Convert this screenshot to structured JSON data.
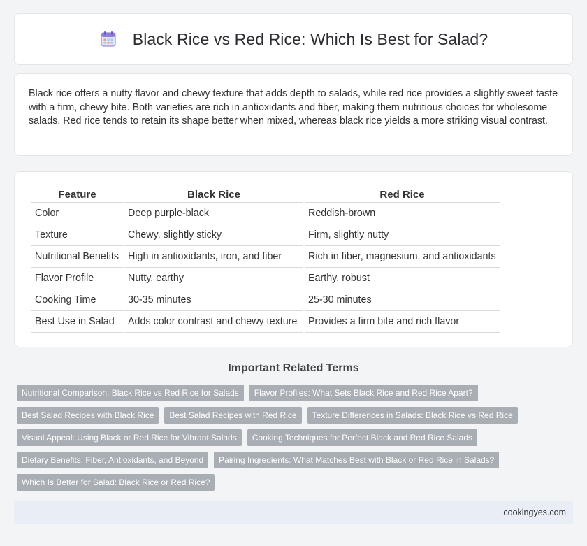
{
  "header": {
    "title": "Black Rice vs Red Rice: Which Is Best for Salad?",
    "icon": "calendar-icon"
  },
  "intro": {
    "text": "Black rice offers a nutty flavor and chewy texture that adds depth to salads, while red rice provides a slightly sweet taste with a firm, chewy bite. Both varieties are rich in antioxidants and fiber, making them nutritious choices for wholesome salads. Red rice tends to retain its shape better when mixed, whereas black rice yields a more striking visual contrast."
  },
  "table": {
    "headers": [
      "Feature",
      "Black Rice",
      "Red Rice"
    ],
    "rows": [
      [
        "Color",
        "Deep purple-black",
        "Reddish-brown"
      ],
      [
        "Texture",
        "Chewy, slightly sticky",
        "Firm, slightly nutty"
      ],
      [
        "Nutritional Benefits",
        "High in antioxidants, iron, and fiber",
        "Rich in fiber, magnesium, and antioxidants"
      ],
      [
        "Flavor Profile",
        "Nutty, earthy",
        "Earthy, robust"
      ],
      [
        "Cooking Time",
        "30-35 minutes",
        "25-30 minutes"
      ],
      [
        "Best Use in Salad",
        "Adds color contrast and chewy texture",
        "Provides a firm bite and rich flavor"
      ]
    ]
  },
  "related": {
    "title": "Important Related Terms",
    "tags": [
      [
        "Nutritional Comparison: Black Rice vs Red Rice for Salads",
        "Flavor Profiles: What Sets Black Rice and Red Rice Apart?"
      ],
      [
        "Best Salad Recipes with Black Rice",
        "Best Salad Recipes with Red Rice",
        "Texture Differences in Salads: Black Rice vs Red Rice"
      ],
      [
        "Visual Appeal: Using Black or Red Rice for Vibrant Salads",
        "Cooking Techniques for Perfect Black and Red Rice Salads"
      ],
      [
        "Dietary Benefits: Fiber, Antioxidants, and Beyond",
        "Pairing Ingredients: What Matches Best with Black or Red Rice in Salads?"
      ],
      [
        "Which Is Better for Salad: Black Rice or Red Rice?"
      ]
    ]
  },
  "footer": {
    "site": "cookingyes.com"
  },
  "colors": {
    "tag_bg": "#a9adb4",
    "footer_bg": "#e9edf5",
    "page_bg": "#f3f4f6"
  }
}
